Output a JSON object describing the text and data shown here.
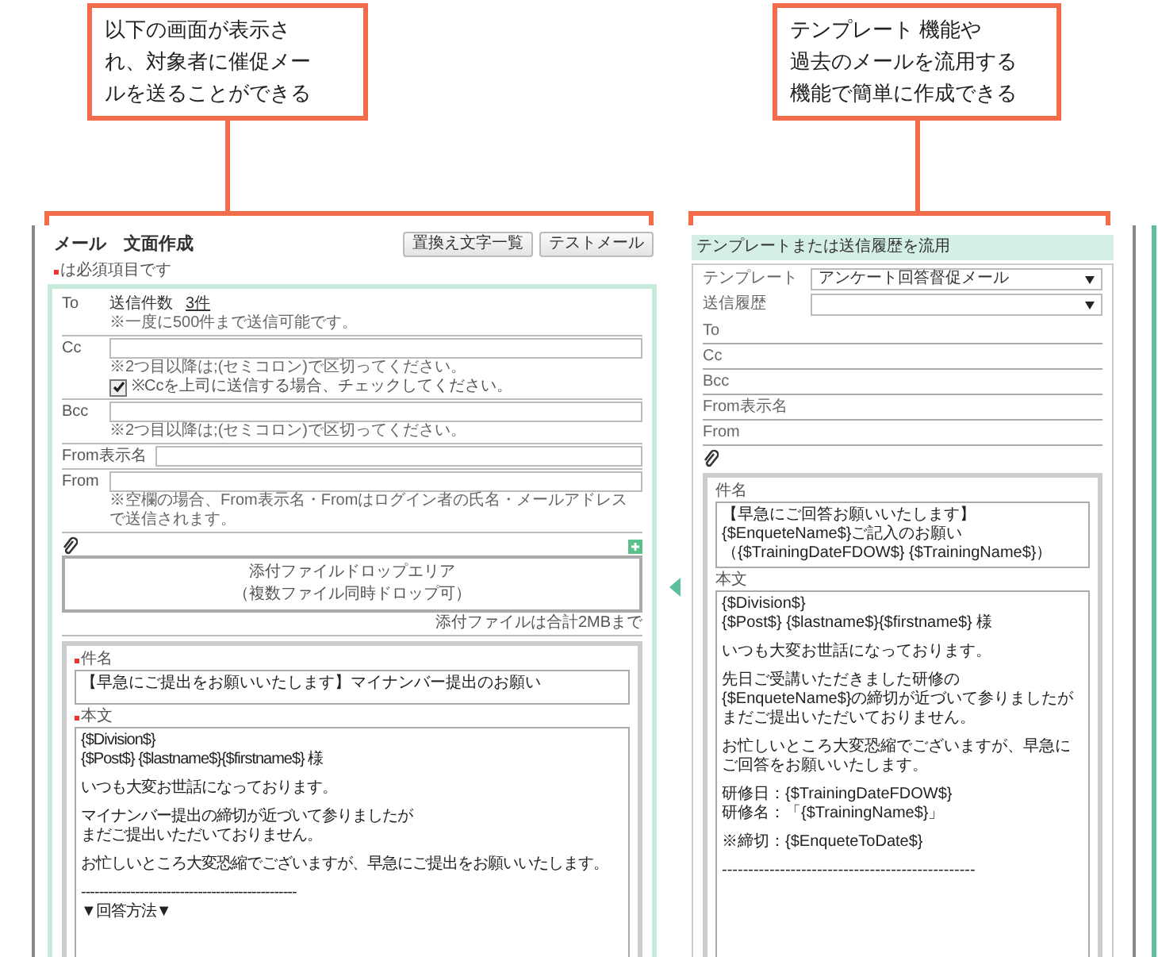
{
  "callouts": [
    {
      "lines": [
        "以下の画面が表示さ",
        "れ、対象者に催促メー",
        "ルを送ることができる"
      ]
    },
    {
      "lines": [
        "テンプレート 機能や",
        "過去のメールを流用する",
        "機能で簡単に作成できる"
      ]
    }
  ],
  "compose": {
    "title": "メール　文面作成",
    "buttons": [
      "置換え文字一覧",
      "テストメール"
    ],
    "required_note": "は必須項目です",
    "fields": [
      {
        "kind": "count",
        "label": "To",
        "count_label": "送信件数",
        "count": "3件",
        "note": "※一度に500件まで送信可能です。"
      },
      {
        "kind": "input",
        "label": "Cc",
        "note": "※2つ目以降は;(セミコロン)で区切ってください。",
        "checkbox": {
          "label": "※Ccを上司に送信する場合、チェックしてください。",
          "checked": true
        }
      },
      {
        "kind": "input",
        "label": "Bcc",
        "note": "※2つ目以降は;(セミコロン)で区切ってください。"
      },
      {
        "kind": "input",
        "label": "From表示名"
      },
      {
        "kind": "input",
        "label": "From",
        "note": "※空欄の場合、From表示名・Fromはログイン者の氏名・メールアドレスで送信されます。"
      }
    ],
    "attachment": {
      "drop_lines": [
        "添付ファイルドロップエリア",
        "（複数ファイル同時ドロップ可）"
      ],
      "limit_note": "添付ファイルは合計2MBまで"
    },
    "subject": {
      "label": "件名",
      "required": true,
      "value": "【早急にご提出をお願いいたします】マイナンバー提出のお願い"
    },
    "body": {
      "label": "本文",
      "required": true,
      "paragraphs": [
        [
          "{$Division$}",
          "{$Post$} {$lastname$}{$firstname$} 様"
        ],
        [
          "いつも大変お世話になっております。"
        ],
        [
          "マイナンバー提出の締切が近づいて参りましたが",
          "まだご提出いただいておりません。"
        ],
        [
          "お忙しいところ大変恐縮でございますが、早急にご提出をお願いいたします。"
        ],
        [
          "------------------------------------------------",
          "▼回答方法▼"
        ]
      ]
    }
  },
  "reuse": {
    "header": "テンプレートまたは送信履歴を流用",
    "selects": [
      {
        "label": "テンプレート",
        "value": "アンケート回答督促メール"
      },
      {
        "label": "送信履歴"
      }
    ],
    "fields": [
      "To",
      "Cc",
      "Bcc",
      "From表示名",
      "From"
    ],
    "subject": {
      "label": "件名",
      "value": "【早急にご回答お願いいたします】{$EnqueteName$}ご記入のお願い（{$TrainingDateFDOW$} {$TrainingName$}）"
    },
    "body": {
      "label": "本文",
      "paragraphs": [
        [
          "{$Division$}",
          "{$Post$} {$lastname$}{$firstname$} 様"
        ],
        [
          "いつも大変お世話になっております。"
        ],
        [
          "先日ご受講いただきました研修の{$EnqueteName$}の締切が近づいて参りましたが",
          "まだご提出いただいておりません。"
        ],
        [
          "お忙しいところ大変恐縮でございますが、早急にご回答をお願いいたします。"
        ],
        [
          "研修日：{$TrainingDateFDOW$}",
          "研修名：「{$TrainingName$}」"
        ],
        [
          "※締切：{$EnqueteToDate$}"
        ],
        [
          "------------------------------------------------"
        ]
      ]
    }
  }
}
